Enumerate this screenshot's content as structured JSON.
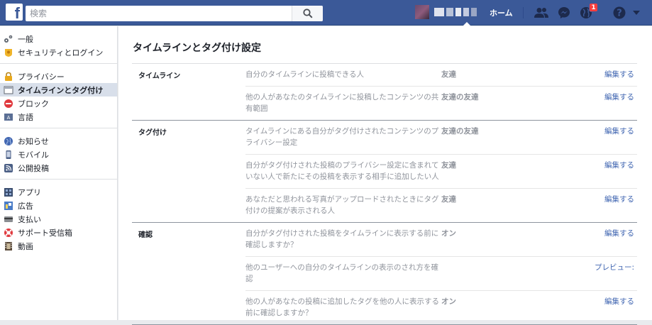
{
  "topbar": {
    "logo": "f",
    "search_placeholder": "検索",
    "home_label": "ホーム",
    "notification_count": "1",
    "brand_color": "#3b5998"
  },
  "sidebar": {
    "groups": [
      [
        {
          "label": "一般",
          "icon": "gears-icon"
        },
        {
          "label": "セキュリティとログイン",
          "icon": "badge-icon"
        }
      ],
      [
        {
          "label": "プライバシー",
          "icon": "lock-icon"
        },
        {
          "label": "タイムラインとタグ付け",
          "icon": "timeline-icon",
          "active": true
        },
        {
          "label": "ブロック",
          "icon": "block-icon"
        },
        {
          "label": "言語",
          "icon": "language-icon"
        }
      ],
      [
        {
          "label": "お知らせ",
          "icon": "globe-icon"
        },
        {
          "label": "モバイル",
          "icon": "mobile-icon"
        },
        {
          "label": "公開投稿",
          "icon": "rss-icon"
        }
      ],
      [
        {
          "label": "アプリ",
          "icon": "apps-icon"
        },
        {
          "label": "広告",
          "icon": "ads-icon"
        },
        {
          "label": "支払い",
          "icon": "card-icon"
        },
        {
          "label": "サポート受信箱",
          "icon": "lifebuoy-icon"
        },
        {
          "label": "動画",
          "icon": "film-icon"
        }
      ]
    ]
  },
  "main": {
    "title": "タイムラインとタグ付け設定",
    "sections": [
      {
        "label": "タイムライン",
        "rows": [
          {
            "desc": "自分のタイムラインに投稿できる人",
            "value": "友達",
            "action": "編集する"
          },
          {
            "desc": "他の人があなたのタイムラインに投稿したコンテンツの共有範囲",
            "value": "友達の友達",
            "action": "編集する"
          }
        ]
      },
      {
        "label": "タグ付け",
        "rows": [
          {
            "desc": "タイムラインにある自分がタグ付けされたコンテンツのプライバシー設定",
            "value": "友達の友達",
            "action": "編集する"
          },
          {
            "desc": "自分がタグ付けされた投稿のプライバシー設定に含まれていない人で新たにその投稿を表示する相手に追加したい人",
            "value": "友達",
            "action": "編集する"
          },
          {
            "desc": "あなただと思われる写真がアップロードされたときにタグ付けの提案が表示される人",
            "value": "友達",
            "action": "編集する"
          }
        ]
      },
      {
        "label": "確認",
        "rows": [
          {
            "desc": "自分がタグ付けされた投稿をタイムラインに表示する前に確認しますか？",
            "value": "オン",
            "action": "編集する"
          },
          {
            "desc": "他のユーザーへの自分のタイムラインの表示のされ方を確認",
            "value": "",
            "action": "プレビュー:"
          },
          {
            "desc": "他の人があなたの投稿に追加したタグを他の人に表示する前に確認しますか？",
            "value": "オン",
            "action": "編集する"
          }
        ]
      }
    ]
  }
}
